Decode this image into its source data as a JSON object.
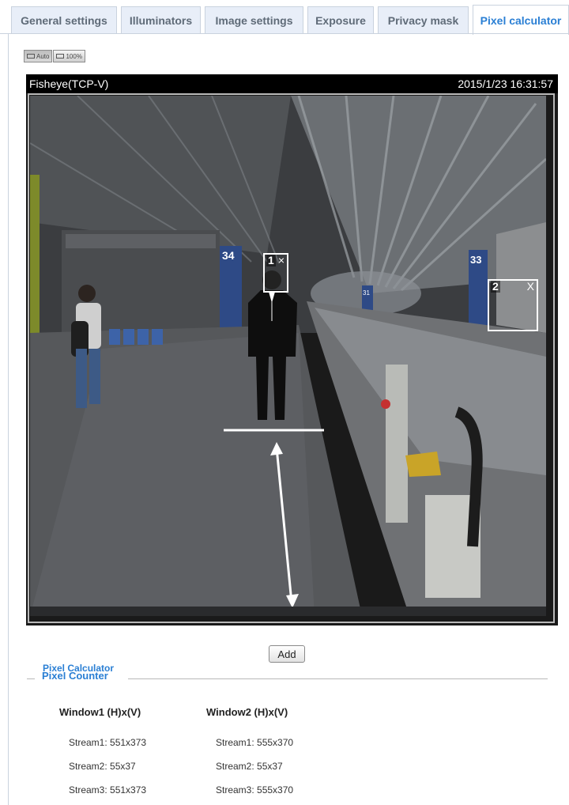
{
  "tabs": [
    {
      "label": "General settings",
      "active": false
    },
    {
      "label": "Illuminators",
      "active": false
    },
    {
      "label": "Image settings",
      "active": false
    },
    {
      "label": "Exposure",
      "active": false
    },
    {
      "label": "Privacy mask",
      "active": false
    },
    {
      "label": "Pixel calculator",
      "active": true
    }
  ],
  "view_buttons": {
    "auto": "Auto",
    "full": "100%"
  },
  "video": {
    "stream_name": "Fisheye(TCP-V)",
    "timestamp": "2015/1/23 16:31:57"
  },
  "scene": {
    "sign_left": "34",
    "sign_right": "33",
    "sign_mid": "31"
  },
  "regions": [
    {
      "number": "1",
      "close": "×"
    },
    {
      "number": "2",
      "close": "X"
    }
  ],
  "add_label": "Add",
  "section_title": "Pixel Calculator",
  "fieldset_legend": "Pixel Counter",
  "windows": [
    {
      "header": "Window1 (H)x(V)",
      "streams": [
        "Stream1: 551x373",
        "Stream2: 55x37",
        "Stream3: 551x373"
      ]
    },
    {
      "header": "Window2 (H)x(V)",
      "streams": [
        "Stream1: 555x370",
        "Stream2: 55x37",
        "Stream3: 555x370"
      ]
    }
  ],
  "colors": {
    "accent": "#2a7fd4",
    "tab_bg": "#e8eef8",
    "roi": "#ffffff"
  }
}
